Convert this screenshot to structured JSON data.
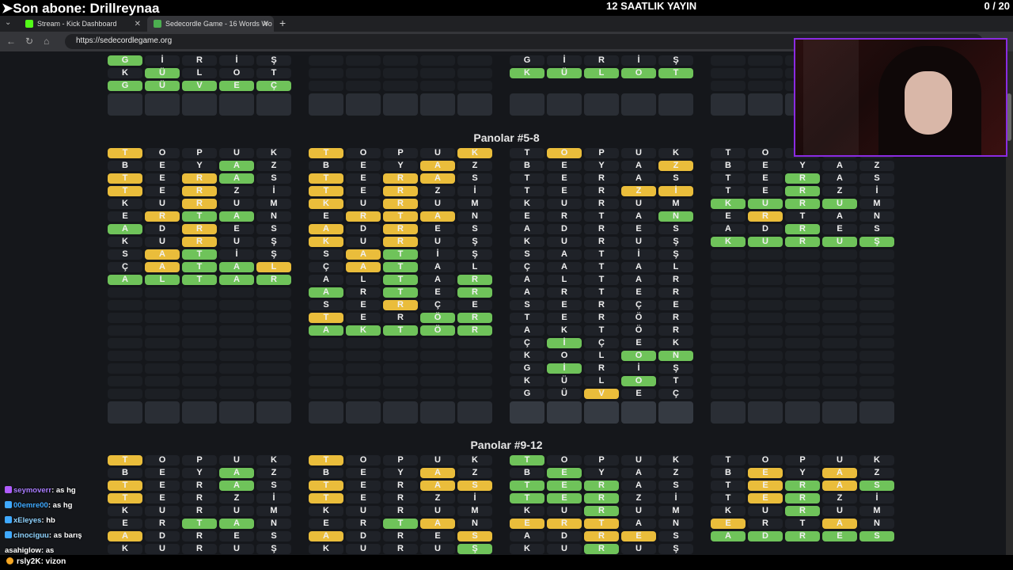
{
  "overlay": {
    "subscriber": "➤Son abone: Drillreynaa",
    "stream_title": "12 SAATLIK YAYIN",
    "counter": "0  / 20"
  },
  "tabs": [
    {
      "label": "Stream - Kick Dashboard",
      "color": "#53fc18"
    },
    {
      "label": "Sedecordle Game - 16 Words Wo",
      "color": "#4caf50"
    }
  ],
  "address": {
    "url": "https://sedecordlegame.org"
  },
  "sections": [
    {
      "title": "Panolar #5-8"
    },
    {
      "title": "Panolar #9-12"
    }
  ],
  "top_boards": [
    {
      "rows": [
        [
          "G|g",
          "İ|",
          "R|",
          "İ|",
          "Ş|"
        ],
        [
          "K|",
          "Ü|g",
          "L|",
          "O|",
          "T|"
        ],
        [
          "G|g",
          "Ü|g",
          "V|g",
          "E|g",
          "Ç|g"
        ]
      ],
      "inputs": 1
    },
    {
      "rows": [
        [
          "|e",
          "|e",
          "|e",
          "|e",
          "|e"
        ],
        [
          "|e",
          "|e",
          "|e",
          "|e",
          "|e"
        ],
        [
          "|e",
          "|e",
          "|e",
          "|e",
          "|e"
        ]
      ],
      "inputs": 1
    },
    {
      "rows": [
        [
          "G|",
          "İ|",
          "R|",
          "İ|",
          "Ş|"
        ],
        [
          "K|g",
          "Ü|g",
          "L|g",
          "O|g",
          "T|g"
        ],
        [
          "|b",
          "|b",
          "|b",
          "|b",
          "|b"
        ]
      ],
      "inputs": 1
    },
    {
      "rows": [
        [
          "|e",
          "|e",
          "|e",
          "|e",
          "|e"
        ],
        [
          "|e",
          "|e",
          "|e",
          "|e",
          "|e"
        ],
        [
          "|e",
          "|e",
          "|e",
          "|e",
          "|e"
        ]
      ],
      "inputs": 1
    }
  ],
  "middle_boards": [
    {
      "rows": [
        [
          "T|y",
          "O|",
          "P|",
          "U|",
          "K|"
        ],
        [
          "B|",
          "E|",
          "Y|",
          "A|g",
          "Z|"
        ],
        [
          "T|y",
          "E|",
          "R|y",
          "A|g",
          "S|"
        ],
        [
          "T|y",
          "E|",
          "R|y",
          "Z|",
          "İ|"
        ],
        [
          "K|",
          "U|",
          "R|y",
          "U|",
          "M|"
        ],
        [
          "E|",
          "R|y",
          "T|g",
          "A|g",
          "N|"
        ],
        [
          "A|g",
          "D|",
          "R|y",
          "E|",
          "S|"
        ],
        [
          "K|",
          "U|",
          "R|y",
          "U|",
          "Ş|"
        ],
        [
          "S|",
          "A|y",
          "T|g",
          "İ|",
          "Ş|"
        ],
        [
          "Ç|",
          "A|y",
          "T|g",
          "A|g",
          "L|y"
        ],
        [
          "A|g",
          "L|g",
          "T|g",
          "A|g",
          "R|g"
        ],
        [
          "|e",
          "|e",
          "|e",
          "|e",
          "|e"
        ],
        [
          "|e",
          "|e",
          "|e",
          "|e",
          "|e"
        ],
        [
          "|e",
          "|e",
          "|e",
          "|e",
          "|e"
        ],
        [
          "|e",
          "|e",
          "|e",
          "|e",
          "|e"
        ],
        [
          "|e",
          "|e",
          "|e",
          "|e",
          "|e"
        ],
        [
          "|e",
          "|e",
          "|e",
          "|e",
          "|e"
        ],
        [
          "|e",
          "|e",
          "|e",
          "|e",
          "|e"
        ],
        [
          "|e",
          "|e",
          "|e",
          "|e",
          "|e"
        ],
        [
          "|e",
          "|e",
          "|e",
          "|e",
          "|e"
        ]
      ],
      "cur": false
    },
    {
      "rows": [
        [
          "T|y",
          "O|",
          "P|",
          "U|",
          "K|y"
        ],
        [
          "B|",
          "E|",
          "Y|",
          "A|y",
          "Z|"
        ],
        [
          "T|y",
          "E|",
          "R|y",
          "A|y",
          "S|"
        ],
        [
          "T|y",
          "E|",
          "R|y",
          "Z|",
          "İ|"
        ],
        [
          "K|y",
          "U|",
          "R|y",
          "U|",
          "M|"
        ],
        [
          "E|",
          "R|y",
          "T|y",
          "A|y",
          "N|"
        ],
        [
          "A|y",
          "D|",
          "R|y",
          "E|",
          "S|"
        ],
        [
          "K|y",
          "U|",
          "R|y",
          "U|",
          "Ş|"
        ],
        [
          "S|",
          "A|y",
          "T|g",
          "İ|",
          "Ş|"
        ],
        [
          "Ç|",
          "A|y",
          "T|g",
          "A|",
          "L|"
        ],
        [
          "A|",
          "L|",
          "T|g",
          "A|",
          "R|g"
        ],
        [
          "A|g",
          "R|",
          "T|g",
          "E|",
          "R|g"
        ],
        [
          "S|",
          "E|",
          "R|y",
          "Ç|",
          "E|"
        ],
        [
          "T|y",
          "E|",
          "R|",
          "Ö|g",
          "R|g"
        ],
        [
          "A|g",
          "K|g",
          "T|g",
          "Ö|g",
          "R|g"
        ],
        [
          "|e",
          "|e",
          "|e",
          "|e",
          "|e"
        ],
        [
          "|e",
          "|e",
          "|e",
          "|e",
          "|e"
        ],
        [
          "|e",
          "|e",
          "|e",
          "|e",
          "|e"
        ],
        [
          "|e",
          "|e",
          "|e",
          "|e",
          "|e"
        ],
        [
          "|e",
          "|e",
          "|e",
          "|e",
          "|e"
        ]
      ],
      "cur": false
    },
    {
      "rows": [
        [
          "T|",
          "O|y",
          "P|",
          "U|",
          "K|"
        ],
        [
          "B|",
          "E|",
          "Y|",
          "A|",
          "Z|y"
        ],
        [
          "T|",
          "E|",
          "R|",
          "A|",
          "S|"
        ],
        [
          "T|",
          "E|",
          "R|",
          "Z|y",
          "İ|y"
        ],
        [
          "K|",
          "U|",
          "R|",
          "U|",
          "M|"
        ],
        [
          "E|",
          "R|",
          "T|",
          "A|",
          "N|g"
        ],
        [
          "A|",
          "D|",
          "R|",
          "E|",
          "S|"
        ],
        [
          "K|",
          "U|",
          "R|",
          "U|",
          "Ş|"
        ],
        [
          "S|",
          "A|",
          "T|",
          "İ|",
          "Ş|"
        ],
        [
          "Ç|",
          "A|",
          "T|",
          "A|",
          "L|"
        ],
        [
          "A|",
          "L|",
          "T|",
          "A|",
          "R|"
        ],
        [
          "A|",
          "R|",
          "T|",
          "E|",
          "R|"
        ],
        [
          "S|",
          "E|",
          "R|",
          "Ç|",
          "E|"
        ],
        [
          "T|",
          "E|",
          "R|",
          "Ö|",
          "R|"
        ],
        [
          "A|",
          "K|",
          "T|",
          "Ö|",
          "R|"
        ],
        [
          "Ç|",
          "İ|g",
          "Ç|",
          "E|",
          "K|"
        ],
        [
          "K|",
          "O|",
          "L|",
          "O|g",
          "N|g"
        ],
        [
          "G|",
          "İ|g",
          "R|",
          "İ|",
          "Ş|"
        ],
        [
          "K|",
          "Ü|",
          "L|",
          "O|g",
          "T|"
        ],
        [
          "G|",
          "Ü|",
          "V|y",
          "E|",
          "Ç|"
        ]
      ],
      "cur": true
    },
    {
      "rows": [
        [
          "T|",
          "O|",
          "P|",
          "U|",
          "K|"
        ],
        [
          "B|",
          "E|",
          "Y|",
          "A|",
          "Z|"
        ],
        [
          "T|",
          "E|",
          "R|g",
          "A|",
          "S|"
        ],
        [
          "T|",
          "E|",
          "R|g",
          "Z|",
          "İ|"
        ],
        [
          "K|g",
          "U|g",
          "R|g",
          "U|g",
          "M|"
        ],
        [
          "E|",
          "R|y",
          "T|",
          "A|",
          "N|"
        ],
        [
          "A|",
          "D|",
          "R|g",
          "E|",
          "S|"
        ],
        [
          "K|g",
          "U|g",
          "R|g",
          "U|g",
          "Ş|g"
        ],
        [
          "|e",
          "|e",
          "|e",
          "|e",
          "|e"
        ],
        [
          "|e",
          "|e",
          "|e",
          "|e",
          "|e"
        ],
        [
          "|e",
          "|e",
          "|e",
          "|e",
          "|e"
        ],
        [
          "|e",
          "|e",
          "|e",
          "|e",
          "|e"
        ],
        [
          "|e",
          "|e",
          "|e",
          "|e",
          "|e"
        ],
        [
          "|e",
          "|e",
          "|e",
          "|e",
          "|e"
        ],
        [
          "|e",
          "|e",
          "|e",
          "|e",
          "|e"
        ],
        [
          "|e",
          "|e",
          "|e",
          "|e",
          "|e"
        ],
        [
          "|e",
          "|e",
          "|e",
          "|e",
          "|e"
        ],
        [
          "|e",
          "|e",
          "|e",
          "|e",
          "|e"
        ],
        [
          "|e",
          "|e",
          "|e",
          "|e",
          "|e"
        ],
        [
          "|e",
          "|e",
          "|e",
          "|e",
          "|e"
        ]
      ],
      "cur": false
    }
  ],
  "bottom_boards": [
    {
      "rows": [
        [
          "T|y",
          "O|",
          "P|",
          "U|",
          "K|"
        ],
        [
          "B|",
          "E|",
          "Y|",
          "A|g",
          "Z|"
        ],
        [
          "T|y",
          "E|",
          "R|",
          "A|g",
          "S|"
        ],
        [
          "T|y",
          "E|",
          "R|",
          "Z|",
          "İ|"
        ],
        [
          "K|",
          "U|",
          "R|",
          "U|",
          "M|"
        ],
        [
          "E|",
          "R|",
          "T|g",
          "A|g",
          "N|"
        ],
        [
          "A|y",
          "D|",
          "R|",
          "E|",
          "S|"
        ],
        [
          "K|",
          "U|",
          "R|",
          "U|",
          "Ş|"
        ]
      ]
    },
    {
      "rows": [
        [
          "T|y",
          "O|",
          "P|",
          "U|",
          "K|"
        ],
        [
          "B|",
          "E|",
          "Y|",
          "A|y",
          "Z|"
        ],
        [
          "T|y",
          "E|",
          "R|",
          "A|y",
          "S|y"
        ],
        [
          "T|y",
          "E|",
          "R|",
          "Z|",
          "İ|"
        ],
        [
          "K|",
          "U|",
          "R|",
          "U|",
          "M|"
        ],
        [
          "E|",
          "R|",
          "T|g",
          "A|y",
          "N|"
        ],
        [
          "A|y",
          "D|",
          "R|",
          "E|",
          "S|y"
        ],
        [
          "K|",
          "U|",
          "R|",
          "U|",
          "Ş|g"
        ]
      ]
    },
    {
      "rows": [
        [
          "T|g",
          "O|",
          "P|",
          "U|",
          "K|"
        ],
        [
          "B|",
          "E|g",
          "Y|",
          "A|",
          "Z|"
        ],
        [
          "T|g",
          "E|g",
          "R|g",
          "A|",
          "S|"
        ],
        [
          "T|g",
          "E|g",
          "R|g",
          "Z|",
          "İ|"
        ],
        [
          "K|",
          "U|",
          "R|g",
          "U|",
          "M|"
        ],
        [
          "E|y",
          "R|y",
          "T|y",
          "A|",
          "N|"
        ],
        [
          "A|",
          "D|",
          "R|y",
          "E|y",
          "S|"
        ],
        [
          "K|",
          "U|",
          "R|g",
          "U|",
          "Ş|"
        ]
      ]
    },
    {
      "rows": [
        [
          "T|",
          "O|",
          "P|",
          "U|",
          "K|"
        ],
        [
          "B|",
          "E|y",
          "Y|",
          "A|y",
          "Z|"
        ],
        [
          "T|",
          "E|y",
          "R|g",
          "A|y",
          "S|g"
        ],
        [
          "T|",
          "E|y",
          "R|g",
          "Z|",
          "İ|"
        ],
        [
          "K|",
          "U|",
          "R|g",
          "U|",
          "M|"
        ],
        [
          "E|y",
          "R|",
          "T|",
          "A|y",
          "N|"
        ],
        [
          "A|g",
          "D|g",
          "R|g",
          "E|g",
          "S|g"
        ],
        [
          "|b",
          "|b",
          "|b",
          "|b",
          "|b"
        ]
      ]
    }
  ],
  "chat": [
    {
      "user": "seymoverr",
      "msg": ": as hg",
      "color": "#a97cff"
    },
    {
      "user": "00emre00",
      "msg": ": as hg",
      "color": "#3fa9ff"
    },
    {
      "user": "xEleyes",
      "msg": ": hb",
      "color": "#8fd3ff"
    },
    {
      "user": "cinociguu",
      "msg": ": as barış",
      "color": "#8fd3ff"
    },
    {
      "user": "asahiglow",
      "msg": ": as",
      "color": "#ffffff"
    }
  ],
  "bottom_chat": {
    "user": "rsly2K",
    "msg": ": vizon"
  }
}
